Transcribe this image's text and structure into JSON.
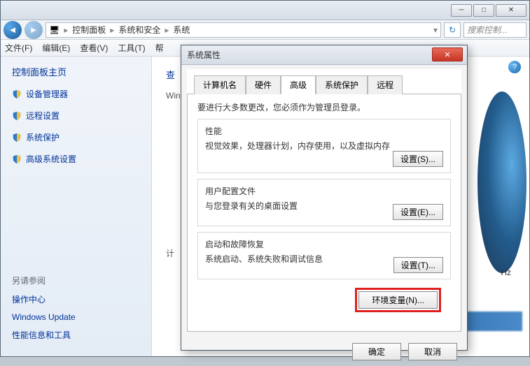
{
  "window": {
    "breadcrumbs": [
      "控制面板",
      "系统和安全",
      "系统"
    ],
    "search_placeholder": "搜索控制..."
  },
  "menubar": {
    "items": [
      "文件(F)",
      "编辑(E)",
      "查看(V)",
      "工具(T)",
      "帮"
    ]
  },
  "sidebar": {
    "home": "控制面板主页",
    "links": [
      "设备管理器",
      "远程设置",
      "系统保护",
      "高级系统设置"
    ],
    "see_also": "另请参阅",
    "links2": [
      "操作中心",
      "Windows Update",
      "性能信息和工具"
    ]
  },
  "content": {
    "heading_partial": "查",
    "sub1": "Win",
    "sub2": "计",
    "right_hz": "Hz"
  },
  "dialog": {
    "title": "系统属性",
    "tabs": [
      "计算机名",
      "硬件",
      "高级",
      "系统保护",
      "远程"
    ],
    "active_tab": 2,
    "notice": "要进行大多数更改，您必须作为管理员登录。",
    "sections": [
      {
        "label": "性能",
        "desc": "视觉效果，处理器计划，内存使用，以及虚拟内存",
        "button": "设置(S)..."
      },
      {
        "label": "用户配置文件",
        "desc": "与您登录有关的桌面设置",
        "button": "设置(E)..."
      },
      {
        "label": "启动和故障恢复",
        "desc": "系统启动、系统失败和调试信息",
        "button": "设置(T)..."
      }
    ],
    "env_button": "环境变量(N)...",
    "ok": "确定",
    "cancel": "取消"
  }
}
